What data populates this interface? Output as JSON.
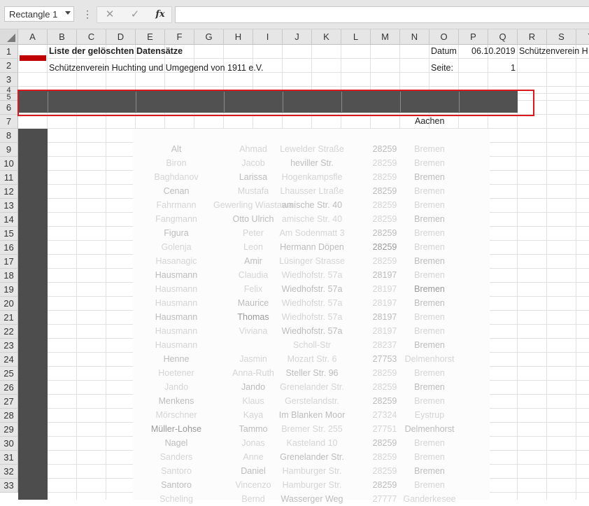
{
  "namebox": {
    "value": "Rectangle 1"
  },
  "formula_bar": {
    "cancel_glyph": "✕",
    "enter_glyph": "✓",
    "fx_label": "fx",
    "menu_glyph": "⋮",
    "value": ""
  },
  "columns": [
    "A",
    "B",
    "C",
    "D",
    "E",
    "F",
    "G",
    "H",
    "I",
    "J",
    "K",
    "L",
    "M",
    "N",
    "O",
    "P",
    "Q",
    "R",
    "S",
    "T"
  ],
  "rows": [
    "1",
    "2",
    "3",
    "4",
    "5",
    "6",
    "7",
    "8",
    "9",
    "10",
    "11",
    "12",
    "13",
    "14",
    "15",
    "16",
    "17",
    "18",
    "19",
    "20",
    "21",
    "22",
    "23",
    "24",
    "25",
    "26",
    "27",
    "28",
    "29",
    "30",
    "31",
    "32",
    "33"
  ],
  "sheet": {
    "title": "Liste der gelöschten Datensätze",
    "club": "Schützenverein Huchting und Umgegend von 1911 e.V.",
    "datum_label": "Datum",
    "datum_value": "06.10.2019",
    "seite_label": "Seite:",
    "seite_value": "1",
    "club_short": "Schützenverein H",
    "row6_city": "Aachen"
  },
  "ghost_rows": [
    [
      "Alt",
      "Ahmad",
      "Lewelder Straße",
      "28259",
      "Bremen"
    ],
    [
      "Biron",
      "Jacob",
      "heviller Str.",
      "28259",
      "Bremen"
    ],
    [
      "Baghdanov",
      "Larissa",
      "Hogenkampsfle",
      "28259",
      "Bremen"
    ],
    [
      "Cenan",
      "Mustafa",
      "Lhausser Ltraße",
      "28259",
      "Bremen"
    ],
    [
      "Fahrmann",
      "Gewerling Wiastawa",
      "amische Str. 40",
      "28259",
      "Bremen"
    ],
    [
      "Fangmann",
      "Otto Ulrich",
      "amische Str. 40",
      "28259",
      "Bremen"
    ],
    [
      "Figura",
      "Peter",
      "Am Sodenmatt 3",
      "28259",
      "Bremen"
    ],
    [
      "Golenja",
      "Leon",
      "Hermann Döpen",
      "28259",
      "Bremen"
    ],
    [
      "Hasanagic",
      "Amir",
      "Lüsinger Strasse",
      "28259",
      "Bremen"
    ],
    [
      "Hausmann",
      "Claudia",
      "Wiedhofstr. 57a",
      "28197",
      "Bremen"
    ],
    [
      "Hausmann",
      "Felix",
      "Wiedhofstr. 57a",
      "28197",
      "Bremen"
    ],
    [
      "Hausmann",
      "Maurice",
      "Wiedhofstr. 57a",
      "28197",
      "Bremen"
    ],
    [
      "Hausmann",
      "Thomas",
      "Wiedhofstr. 57a",
      "28197",
      "Bremen"
    ],
    [
      "Hausmann",
      "Viviana",
      "Wiedhofstr. 57a",
      "28197",
      "Bremen"
    ],
    [
      "Hausmann",
      "",
      "Scholl-Str",
      "28237",
      "Bremen"
    ],
    [
      "Henne",
      "Jasmin",
      "Mozart Str. 6",
      "27753",
      "Delmenhorst"
    ],
    [
      "Hoetener",
      "Anna-Ruth",
      "Steller Str. 96",
      "28259",
      "Bremen"
    ],
    [
      "Jando",
      "Jando",
      "Grenelander Str.",
      "28259",
      "Bremen"
    ],
    [
      "Menkens",
      "Klaus",
      "Gerstelandstr.",
      "28259",
      "Bremen"
    ],
    [
      "Mörschner",
      "Kaya",
      "Im Blanken Moor",
      "27324",
      "Eystrup"
    ],
    [
      "Müller-Lohse",
      "Tammo",
      "Bremer Str. 255",
      "27751",
      "Delmenhorst"
    ],
    [
      "Nagel",
      "Jonas",
      "Kasteland 10",
      "28259",
      "Bremen"
    ],
    [
      "Sanders",
      "Anne",
      "Grenelander Str.",
      "28259",
      "Bremen"
    ],
    [
      "Santoro",
      "Daniel",
      "Hamburger Str.",
      "28259",
      "Bremen"
    ],
    [
      "Santoro",
      "Vincenzo",
      "Hamburger Str.",
      "28259",
      "Bremen"
    ],
    [
      "Scheling",
      "Bernd",
      "Wasserger Weg",
      "27777",
      "Ganderkesee"
    ]
  ]
}
